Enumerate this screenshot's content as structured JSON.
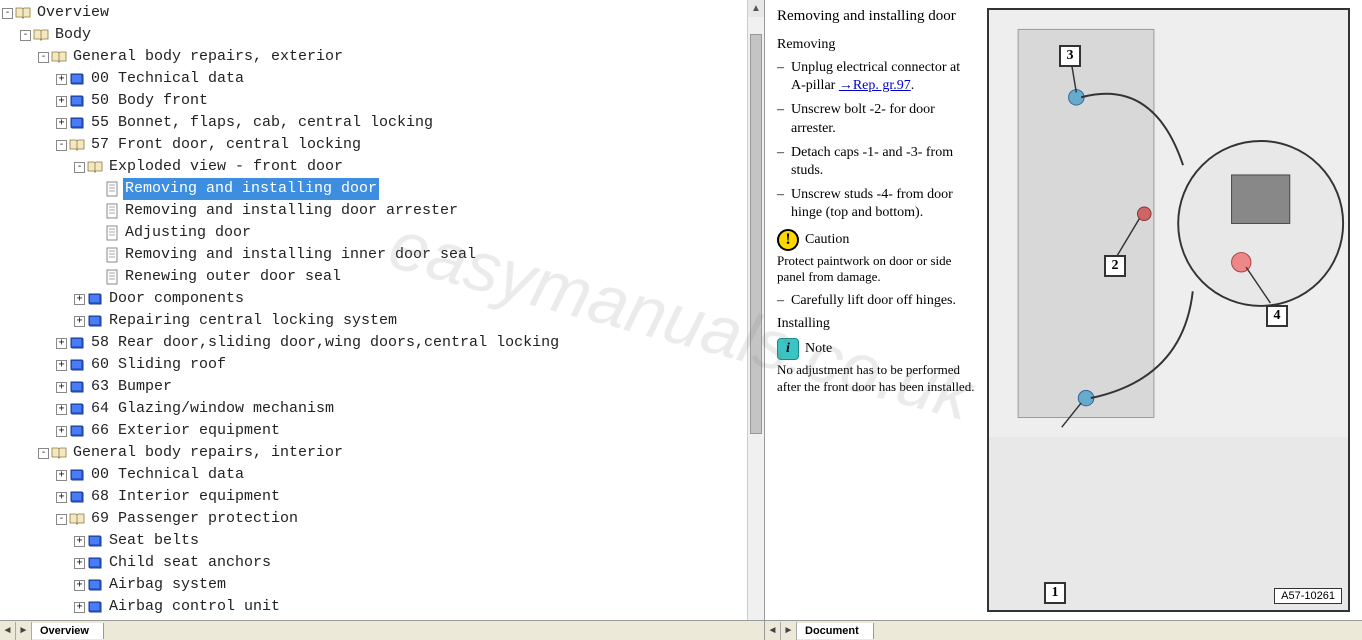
{
  "tree": {
    "overview": "Overview",
    "body": "Body",
    "gbre": "General body repairs, exterior",
    "s00": "00 Technical data",
    "s50": "50 Body front",
    "s55": "55 Bonnet, flaps, cab, central locking",
    "s57": "57 Front door, central locking",
    "exploded": "Exploded view - front door",
    "remove_install": "Removing and installing door",
    "remove_install_arrester": "Removing and installing door arrester",
    "adjusting": "Adjusting door",
    "inner_seal": "Removing and installing inner door seal",
    "outer_seal": "Renewing outer door seal",
    "door_components": "Door components",
    "repair_central": "Repairing central locking system",
    "s58": "58 Rear door,sliding door,wing doors,central locking",
    "s60": "60 Sliding roof",
    "s63": "63 Bumper",
    "s64": "64 Glazing/window mechanism",
    "s66": "66 Exterior equipment",
    "gbri": "General body repairs, interior",
    "i00": "00 Technical data",
    "s68": "68 Interior equipment",
    "s69": "69 Passenger protection",
    "seatbelts": "Seat belts",
    "childseat": "Child seat anchors",
    "airbag_sys": "Airbag system",
    "airbag_ctrl": "Airbag control unit"
  },
  "tabs": {
    "left": "Overview",
    "right": "Document"
  },
  "doc": {
    "title": "Removing and installing door",
    "removing": "Removing",
    "step1a": "Unplug electrical connector at A-pillar",
    "step1b": "→Rep. gr.97",
    "step2": "Unscrew bolt -2- for door arrester.",
    "step3": "Detach caps -1- and -3- from studs.",
    "step4": "Unscrew studs -4- from door hinge (top and bottom).",
    "caution": "Caution",
    "caution_text": "Protect paintwork on door or side panel from damage.",
    "step5": "Carefully lift door off hinges.",
    "installing": "Installing",
    "note": "Note",
    "note_text": "No adjustment has to be performed after the front door has been installed."
  },
  "diagram": {
    "c1": "1",
    "c2": "2",
    "c3": "3",
    "c4": "4",
    "ref": "A57-10261"
  },
  "watermark": "easymanuals.co.uk"
}
